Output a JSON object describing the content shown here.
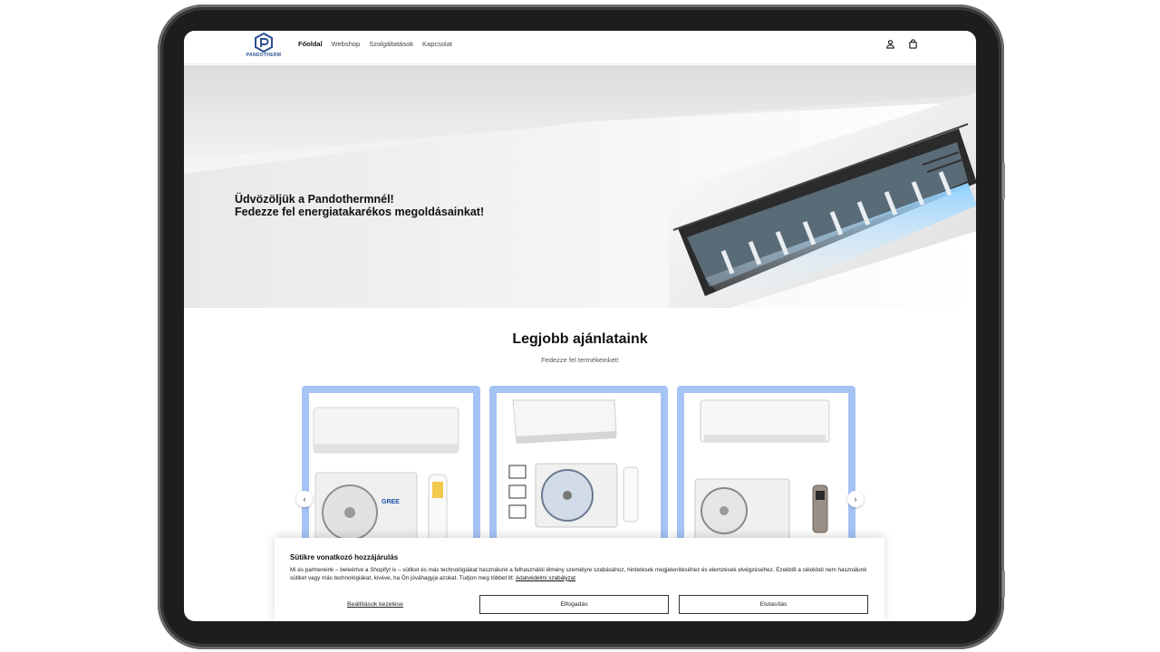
{
  "brand": {
    "name": "PANDOTHERM",
    "color": "#2a4f8f"
  },
  "nav": {
    "items": [
      {
        "label": "Főoldal",
        "active": true
      },
      {
        "label": "Webshop",
        "active": false
      },
      {
        "label": "Szolgáltatások",
        "active": false
      },
      {
        "label": "Kapcsolat",
        "active": false
      }
    ]
  },
  "header_icons": [
    "account-icon",
    "cart-icon"
  ],
  "hero": {
    "line1": "Üdvözöljük a Pandothermnél!",
    "line2": "Fedezze fel energiatakarékos megoldásainkat!"
  },
  "products": {
    "title": "Legjobb ajánlataink",
    "subtitle": "Fedezze fel termékeinket!",
    "card_border_color": "#a6c3f5",
    "cards": [
      {
        "brand_logo": "GREE"
      },
      {
        "brand_logo": ""
      },
      {
        "brand_logo": ""
      }
    ]
  },
  "cookie": {
    "title": "Sütikre vonatkozó hozzájárulás",
    "text": "Mi és partnereink – beleértve a Shopifyt is – sütiket és más technológiákat használunk a felhasználói élmény személyre szabásához, hirdetések megjelenítéséhez és elemzések elvégzéséhez. Ezekből a célokból nem használunk sütiket vagy más technológiákat, kivéve, ha Ön jóváhagyja azokat. Tudjon meg többet itt:",
    "policy_link": "Adatvédelmi szabályzat",
    "manage_label": "Beállítások kezelése",
    "accept_label": "Elfogadás",
    "decline_label": "Elutasítás"
  }
}
